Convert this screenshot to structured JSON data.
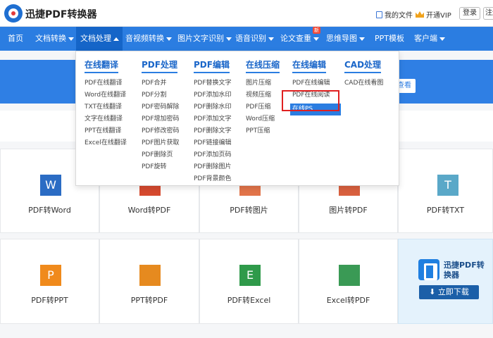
{
  "header": {
    "logo_text": "迅捷PDF转换器",
    "my_files": "我的文件",
    "open_vip": "开通VIP",
    "login": "登录",
    "register": "注册"
  },
  "nav": {
    "items": [
      "首页",
      "文档转换",
      "文档处理",
      "音视频转换",
      "图片文字识别",
      "语音识别",
      "论文查重",
      "思维导图",
      "PPT模板",
      "客户端"
    ],
    "new_badge": "新"
  },
  "banner": {
    "button": "查看"
  },
  "dropdown": {
    "columns": [
      {
        "head": "在线翻译",
        "items": [
          "PDF在线翻译",
          "Word在线翻译",
          "TXT在线翻译",
          "文字在线翻译",
          "PPT在线翻译",
          "Excel在线翻译"
        ]
      },
      {
        "head": "PDF处理",
        "items": [
          "PDF合并",
          "PDF分割",
          "PDF密码解除",
          "PDF增加密码",
          "PDF修改密码",
          "PDF图片获取",
          "PDF删除页",
          "PDF旋转"
        ]
      },
      {
        "head": "PDF编辑",
        "items": [
          "PDF替换文字",
          "PDF添加水印",
          "PDF删除水印",
          "PDF添加文字",
          "PDF删除文字",
          "PDF链接编辑",
          "PDF添加页码",
          "PDF删除图片",
          "PDF背景颜色"
        ]
      },
      {
        "head": "在线压缩",
        "items": [
          "图片压缩",
          "视频压缩",
          "PDF压缩",
          "Word压缩",
          "PPT压缩"
        ]
      },
      {
        "head": "在线编辑",
        "items": [
          "PDF在线编辑",
          "PDF在线阅读",
          "在线PS"
        ]
      },
      {
        "head": "CAD处理",
        "items": [
          "CAD在线看图"
        ]
      }
    ]
  },
  "cards": {
    "row1": [
      "PDF转Word",
      "Word转PDF",
      "PDF转图片",
      "图片转PDF",
      "PDF转TXT"
    ],
    "row2": [
      "PDF转PPT",
      "PPT转PDF",
      "PDF转Excel",
      "Excel转PDF"
    ]
  },
  "icons": {
    "row1": [
      "W",
      "",
      "",
      "",
      "T"
    ],
    "row2": [
      "P",
      "",
      "E",
      ""
    ]
  },
  "promo": {
    "name": "迅捷PDF转换器",
    "download": "立即下载"
  },
  "colors": {
    "nav": "#2b7de1",
    "accent_red": "#e02020"
  }
}
